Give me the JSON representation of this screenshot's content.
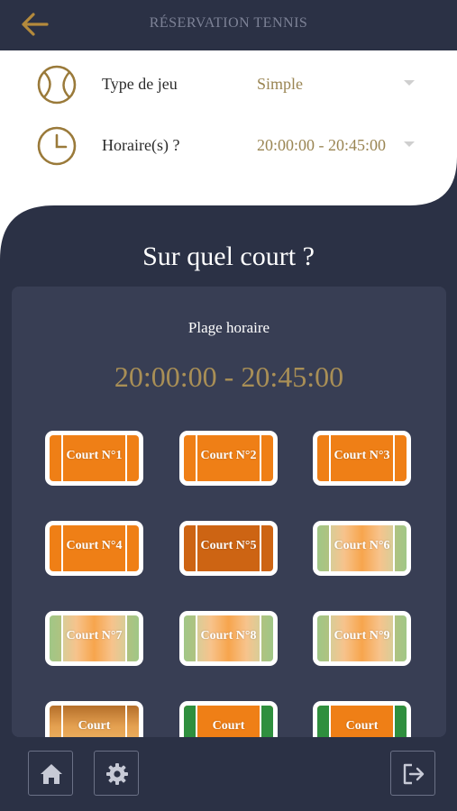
{
  "header": {
    "title": "RÉSERVATION TENNIS",
    "back_icon": "arrow-left-icon"
  },
  "options": {
    "game_type": {
      "icon": "tennis-ball-icon",
      "label": "Type de jeu",
      "value": "Simple"
    },
    "schedule": {
      "icon": "clock-icon",
      "label": "Horaire(s) ?",
      "value": "20:00:00 - 20:45:00"
    }
  },
  "question": "Sur quel court ?",
  "slot": {
    "label": "Plage horaire",
    "time": "20:00:00 - 20:45:00"
  },
  "courts": [
    {
      "name": "Court N°1",
      "style": "orange"
    },
    {
      "name": "Court N°2",
      "style": "orange"
    },
    {
      "name": "Court N°3",
      "style": "orange"
    },
    {
      "name": "Court N°4",
      "style": "orange"
    },
    {
      "name": "Court N°5",
      "style": "dark-orange"
    },
    {
      "name": "Court N°6",
      "style": "green-gradient"
    },
    {
      "name": "Court N°7",
      "style": "green-gradient"
    },
    {
      "name": "Court N°8",
      "style": "green-gradient"
    },
    {
      "name": "Court N°9",
      "style": "green-gradient"
    },
    {
      "name": "Court",
      "style": "bronze"
    },
    {
      "name": "Court",
      "style": "orange-green"
    },
    {
      "name": "Court",
      "style": "orange-green"
    }
  ],
  "bottom_nav": {
    "home_icon": "home-icon",
    "settings_icon": "gear-icon",
    "logout_icon": "logout-icon"
  },
  "colors": {
    "background": "#2b3145",
    "card": "#383e54",
    "accent_gold": "#a98f56",
    "court_orange": "#ef7f16"
  }
}
